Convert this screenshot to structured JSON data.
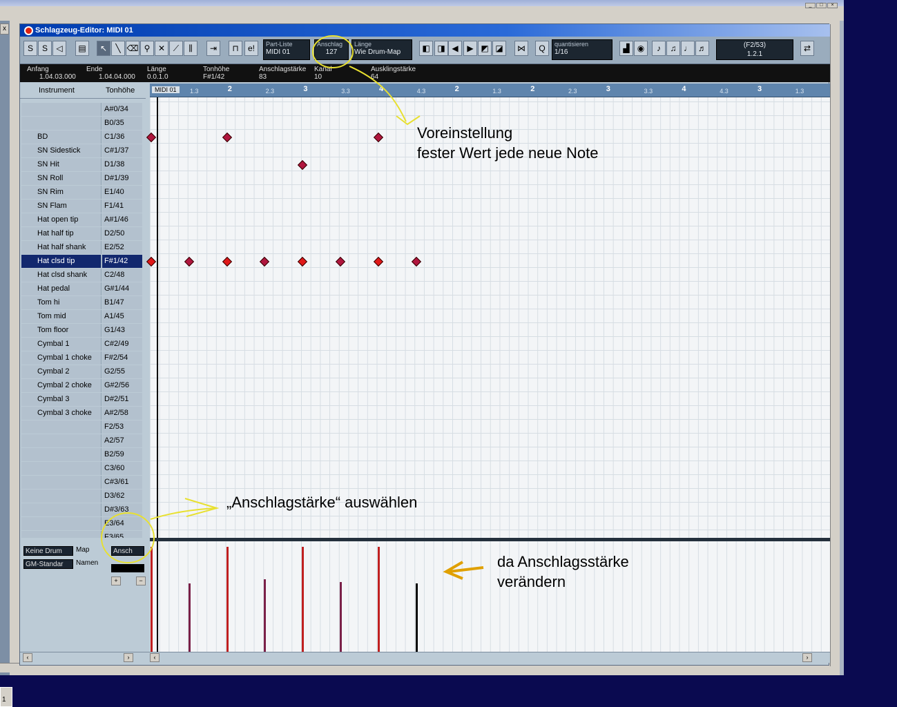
{
  "window": {
    "title": "Schlagzeug-Editor: MIDI 01",
    "close_glyph": "x",
    "winbtns": [
      "_",
      "□",
      "×"
    ]
  },
  "toolbar": {
    "solo": "S",
    "part_list": {
      "label": "Part-Liste",
      "value": "MIDI 01"
    },
    "velocity": {
      "label": "Anschlag",
      "value": "127"
    },
    "length": {
      "label": "Länge",
      "value": "Wie Drum-Map"
    },
    "quantize": {
      "label": "quantisieren",
      "value": "1/16"
    },
    "position": {
      "label": "(F2/53)",
      "value": "1.2.1"
    }
  },
  "info": [
    {
      "label": "Anfang",
      "value": "1.04.03.000"
    },
    {
      "label": "Ende",
      "value": "1.04.04.000"
    },
    {
      "label": "Länge",
      "value": "0.0.1.0"
    },
    {
      "label": "Tonhöhe",
      "value": "F#1/42"
    },
    {
      "label": "Anschlagstärke",
      "value": "83"
    },
    {
      "label": "Kanal",
      "value": "10"
    },
    {
      "label": "Ausklingstärke",
      "value": "64"
    }
  ],
  "list": {
    "header_instrument": "Instrument",
    "header_pitch": "Tonhöhe",
    "rows": [
      {
        "name": "",
        "pitch": "A#0/34"
      },
      {
        "name": "",
        "pitch": "B0/35"
      },
      {
        "name": "BD",
        "pitch": "C1/36"
      },
      {
        "name": "SN Sidestick",
        "pitch": "C#1/37"
      },
      {
        "name": "SN Hit",
        "pitch": "D1/38"
      },
      {
        "name": "SN Roll",
        "pitch": "D#1/39"
      },
      {
        "name": "SN Rim",
        "pitch": "E1/40"
      },
      {
        "name": "SN Flam",
        "pitch": "F1/41"
      },
      {
        "name": "Hat open tip",
        "pitch": "A#1/46"
      },
      {
        "name": "Hat half tip",
        "pitch": "D2/50"
      },
      {
        "name": "Hat half shank",
        "pitch": "E2/52"
      },
      {
        "name": "Hat clsd tip",
        "pitch": "F#1/42",
        "selected": true
      },
      {
        "name": "Hat clsd shank",
        "pitch": "C2/48"
      },
      {
        "name": "Hat pedal",
        "pitch": "G#1/44"
      },
      {
        "name": "Tom hi",
        "pitch": "B1/47"
      },
      {
        "name": "Tom mid",
        "pitch": "A1/45"
      },
      {
        "name": "Tom floor",
        "pitch": "G1/43"
      },
      {
        "name": "Cymbal 1",
        "pitch": "C#2/49"
      },
      {
        "name": "Cymbal 1 choke",
        "pitch": "F#2/54"
      },
      {
        "name": "Cymbal 2",
        "pitch": "G2/55"
      },
      {
        "name": "Cymbal 2 choke",
        "pitch": "G#2/56"
      },
      {
        "name": "Cymbal 3",
        "pitch": "D#2/51"
      },
      {
        "name": "Cymbal 3 choke",
        "pitch": "A#2/58"
      },
      {
        "name": "",
        "pitch": "F2/53"
      },
      {
        "name": "",
        "pitch": "A2/57"
      },
      {
        "name": "",
        "pitch": "B2/59"
      },
      {
        "name": "",
        "pitch": "C3/60"
      },
      {
        "name": "",
        "pitch": "C#3/61"
      },
      {
        "name": "",
        "pitch": "D3/62"
      },
      {
        "name": "",
        "pitch": "D#3/63"
      },
      {
        "name": "",
        "pitch": "E3/64"
      },
      {
        "name": "",
        "pitch": "F3/65"
      }
    ]
  },
  "ruler": {
    "part_label": "MIDI 01",
    "ticks": [
      "1.3",
      "2",
      "2.3",
      "3",
      "3.3",
      "4",
      "4.3",
      "2",
      "1.3",
      "2",
      "2.3",
      "3",
      "3.3",
      "4",
      "4.3",
      "3",
      "1.3"
    ]
  },
  "notes": {
    "BD": [
      1,
      2,
      4
    ],
    "SN Hit": [
      3
    ],
    "Hat clsd tip": [
      1,
      1.5,
      2,
      2.5,
      3,
      3.5,
      4,
      4.5
    ]
  },
  "velocities": [
    {
      "beat": 1,
      "value": 127,
      "color": "#c02020"
    },
    {
      "beat": 1.5,
      "value": 83,
      "color": "#7a2048"
    },
    {
      "beat": 2,
      "value": 127,
      "color": "#c02020"
    },
    {
      "beat": 2.5,
      "value": 88,
      "color": "#7a2048"
    },
    {
      "beat": 3,
      "value": 127,
      "color": "#c02020"
    },
    {
      "beat": 3.5,
      "value": 84,
      "color": "#7a2048"
    },
    {
      "beat": 4,
      "value": 127,
      "color": "#c02020"
    },
    {
      "beat": 4.5,
      "value": 83,
      "color": "#000000"
    }
  ],
  "controller": {
    "drum_map": "Keine Drum",
    "map_label": "Map",
    "name_set": "GM-Standar",
    "names_label": "Namen",
    "lane": "Ansch"
  },
  "annotations": {
    "preset": [
      "Voreinstellung",
      "fester Wert jede neue Note"
    ],
    "select": "„Anschlagstärke“ auswählen",
    "change": [
      "da Anschlagsstärke",
      "verändern"
    ]
  },
  "colors": {
    "note": "#b0163e",
    "note_selected": "#e01818",
    "highlight_circle": "#e8e030",
    "arrow_orange": "#e0a000"
  },
  "taskbar": "1"
}
